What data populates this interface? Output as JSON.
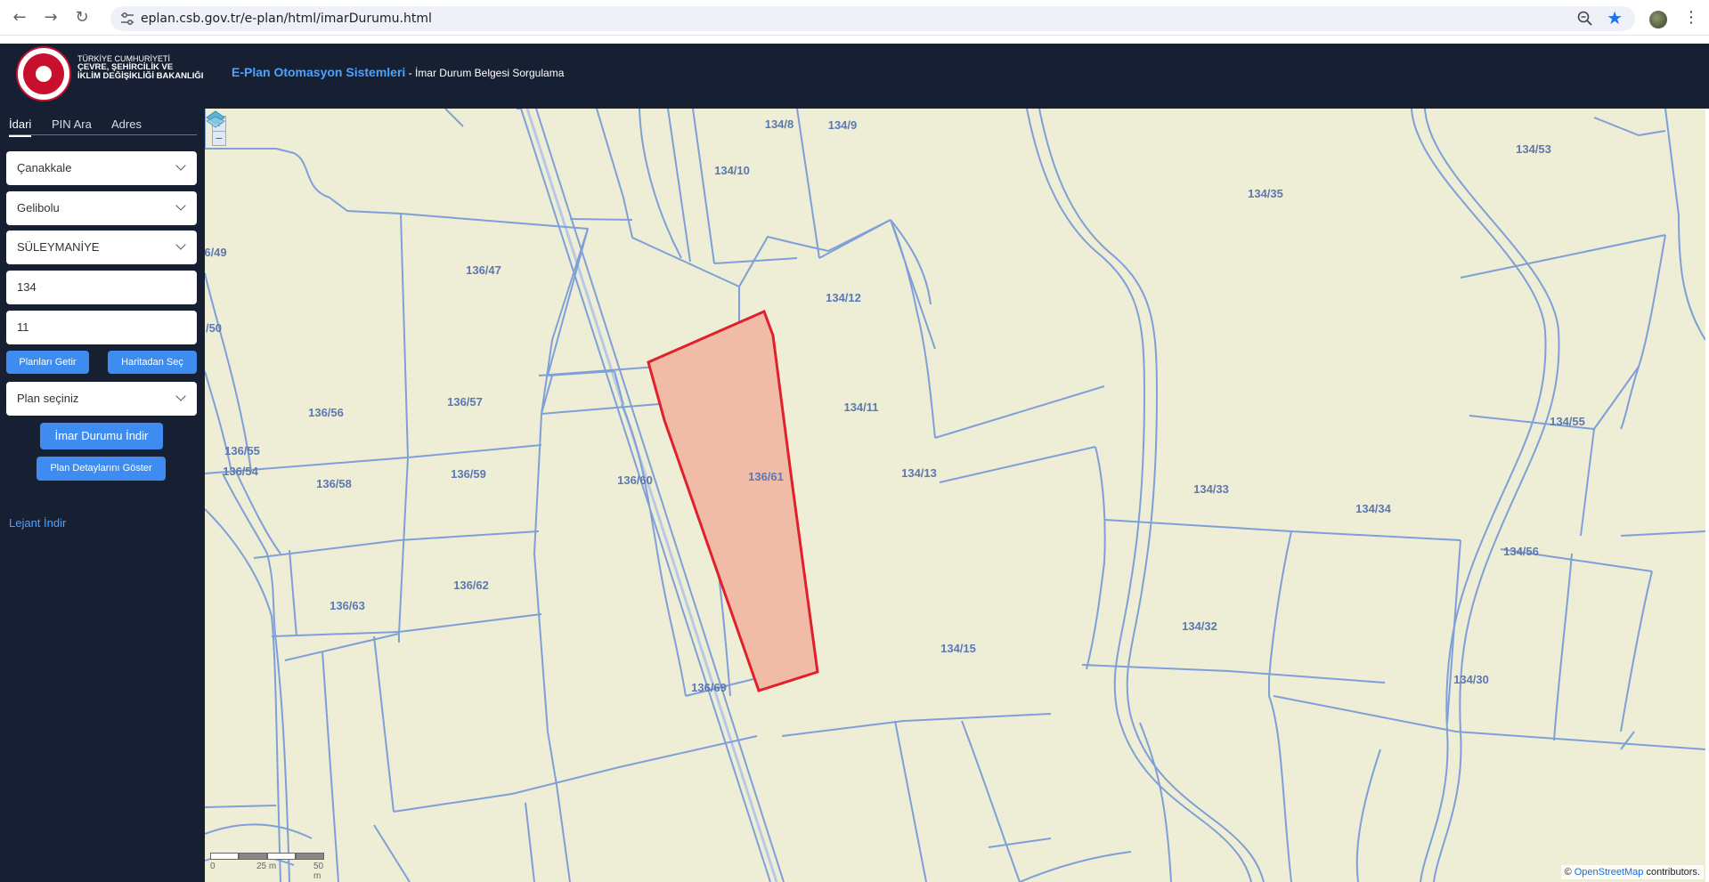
{
  "browser": {
    "url": "eplan.csb.gov.tr/e-plan/html/imarDurumu.html",
    "icons": [
      "back-arrow-icon",
      "forward-arrow-icon",
      "reload-icon",
      "site-info-icon",
      "zoom-icon",
      "star-icon",
      "profile-avatar",
      "more-menu-icon"
    ]
  },
  "header": {
    "ministry_line1": "TÜRKİYE CUMHURİYETİ",
    "ministry_line2": "ÇEVRE, ŞEHİRCİLİK VE",
    "ministry_line3": "İKLİM DEĞİŞİKLİĞİ BAKANLIĞI",
    "app_name": "E-Plan Otomasyon Sistemleri",
    "separator": " - ",
    "page_name": "İmar Durum Belgesi Sorgulama"
  },
  "sidebar": {
    "tabs": [
      {
        "label": "İdari",
        "active": true
      },
      {
        "label": "PIN Ara",
        "active": false
      },
      {
        "label": "Adres",
        "active": false
      }
    ],
    "province": "Çanakkale",
    "district": "Gelibolu",
    "neighborhood": "SÜLEYMANİYE",
    "block": "134",
    "parcel": "11",
    "btn_get_plans": "Planları Getir",
    "btn_select_map": "Haritadan Seç",
    "plan_select": "Plan seçiniz",
    "btn_download": "İmar Durumu İndir",
    "btn_details": "Plan Detaylarını Göster",
    "legend_link": "Lejant İndir"
  },
  "map": {
    "zoom_in": "+",
    "zoom_out": "−",
    "scale_labels": [
      "0",
      "25 m",
      "50 m"
    ],
    "attribution_prefix": "© ",
    "attribution_link": "OpenStreetMap",
    "attribution_suffix": " contributors.",
    "selected_parcel": "134/11",
    "colors": {
      "background": "#eeeed6",
      "parcel_line": "#7f9fd8",
      "label": "#5c78b3",
      "selected_fill": "#f0bca8",
      "selected_stroke": "#e0202a"
    },
    "parcel_labels": [
      "134/9",
      "134/8",
      "134/10",
      "134/35",
      "134/53",
      "6/49",
      "136/47",
      "134/12",
      "/50",
      "134/11",
      "136/56",
      "136/57",
      "134/55",
      "136/55",
      "136/54",
      "136/58",
      "136/59",
      "136/60",
      "136/61",
      "134/13",
      "134/33",
      "134/34",
      "134/56",
      "136/62",
      "136/63",
      "134/32",
      "134/15",
      "136/69",
      "134/30"
    ]
  }
}
